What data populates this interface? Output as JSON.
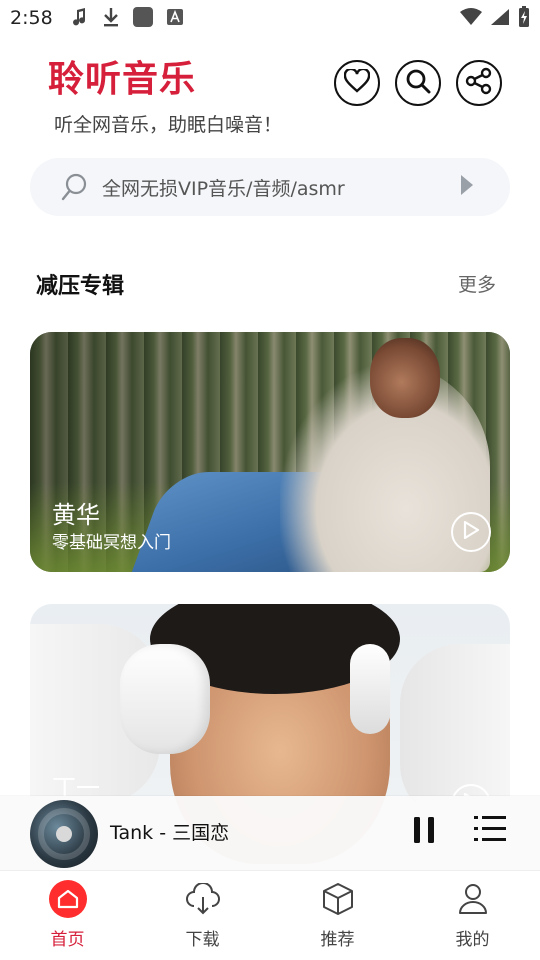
{
  "status_bar": {
    "time": "2:58",
    "left_icons": [
      "music-note-icon",
      "download-icon",
      "app-square-icon",
      "keyboard-a-icon"
    ],
    "right_icons": [
      "wifi-icon",
      "signal-icon",
      "battery-charging-icon"
    ]
  },
  "header": {
    "title": "聆听音乐",
    "subtitle": "听全网音乐，助眠白噪音！",
    "actions": [
      "heart-icon",
      "search-icon",
      "share-icon"
    ]
  },
  "search": {
    "placeholder": "全网无损VIP音乐/音频/asmr"
  },
  "section": {
    "title": "减压专辑",
    "more": "更多"
  },
  "albums": [
    {
      "title": "黄华",
      "subtitle": "零基础冥想入门"
    },
    {
      "title": "丁一",
      "subtitle": ""
    }
  ],
  "player": {
    "track": "Tank - 三国恋",
    "state": "playing"
  },
  "nav": {
    "items": [
      {
        "label": "首页",
        "icon": "home-icon",
        "active": true
      },
      {
        "label": "下载",
        "icon": "cloud-download-icon",
        "active": false
      },
      {
        "label": "推荐",
        "icon": "cube-icon",
        "active": false
      },
      {
        "label": "我的",
        "icon": "person-icon",
        "active": false
      }
    ]
  },
  "colors": {
    "accent": "#d61f3a",
    "home_badge": "#ff2d2d",
    "search_bg": "#f4f6f9"
  }
}
